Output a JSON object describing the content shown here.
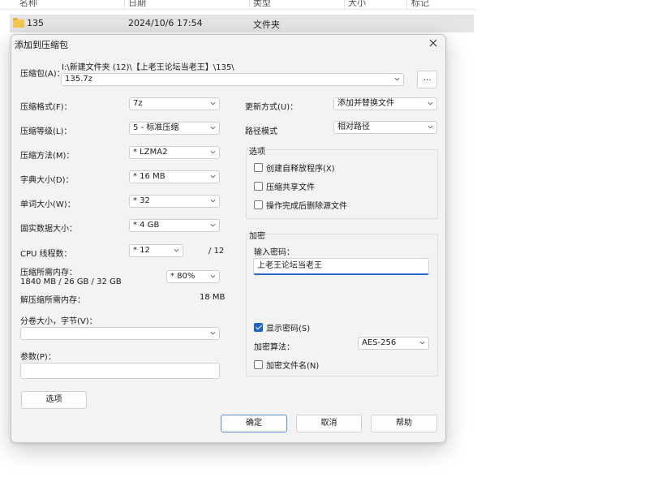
{
  "explorer": {
    "columns": {
      "name": "名称",
      "date": "日期",
      "type": "类型",
      "size": "大小",
      "tags": "标记"
    },
    "row": {
      "name": "135",
      "date": "2024/10/6 17:54",
      "type": "文件夹"
    }
  },
  "dialog": {
    "title": "添加到压缩包",
    "archive": {
      "label": "压缩包(A)：",
      "path": "I:\\新建文件夹 (12)\\【上老王论坛当老王】\\135\\",
      "value": "135.7z",
      "browse_label": "..."
    },
    "left": {
      "format": {
        "label": "压缩格式(F)：",
        "value": "7z"
      },
      "level": {
        "label": "压缩等级(L)：",
        "value": "5 - 标准压缩"
      },
      "method": {
        "label": "压缩方法(M)：",
        "value": "* LZMA2"
      },
      "dict": {
        "label": "字典大小(D)：",
        "value": "* 16 MB"
      },
      "word": {
        "label": "单词大小(W)：",
        "value": "* 32"
      },
      "solid": {
        "label": "固实数据大小：",
        "value": "* 4 GB"
      },
      "threads": {
        "label": "CPU 线程数：",
        "value": "* 12",
        "max": "/ 12"
      },
      "mem": {
        "label": "压缩所需内存：",
        "detail": "1840 MB / 26 GB / 32 GB",
        "value": "* 80%"
      },
      "decomp": {
        "label": "解压缩所需内存：",
        "value": "18 MB"
      },
      "split": {
        "label": "分卷大小，字节(V)：",
        "value": ""
      },
      "params": {
        "label": "参数(P)：",
        "value": ""
      },
      "options_button": "选项"
    },
    "right": {
      "update": {
        "label": "更新方式(U)：",
        "value": "添加并替换文件"
      },
      "pathmode": {
        "label": "路径模式",
        "value": "相对路径"
      },
      "options_group": {
        "title": "选项",
        "sfx": {
          "label": "创建自释放程序(X)",
          "checked": false
        },
        "shared": {
          "label": "压缩共享文件",
          "checked": false
        },
        "delete": {
          "label": "操作完成后删除源文件",
          "checked": false
        }
      },
      "encrypt_group": {
        "title": "加密",
        "password_label": "输入密码：",
        "password_value": "上老王论坛当老王",
        "show_password": {
          "label": "显示密码(S)",
          "checked": true
        },
        "method_label": "加密算法：",
        "method_value": "AES-256",
        "encrypt_names": {
          "label": "加密文件名(N)",
          "checked": false
        }
      }
    },
    "buttons": {
      "ok": "确定",
      "cancel": "取消",
      "help": "帮助"
    }
  },
  "colors": {
    "accent": "#1e63c8",
    "folder": "#f4c752",
    "selected_row": "#e5e5e5"
  }
}
